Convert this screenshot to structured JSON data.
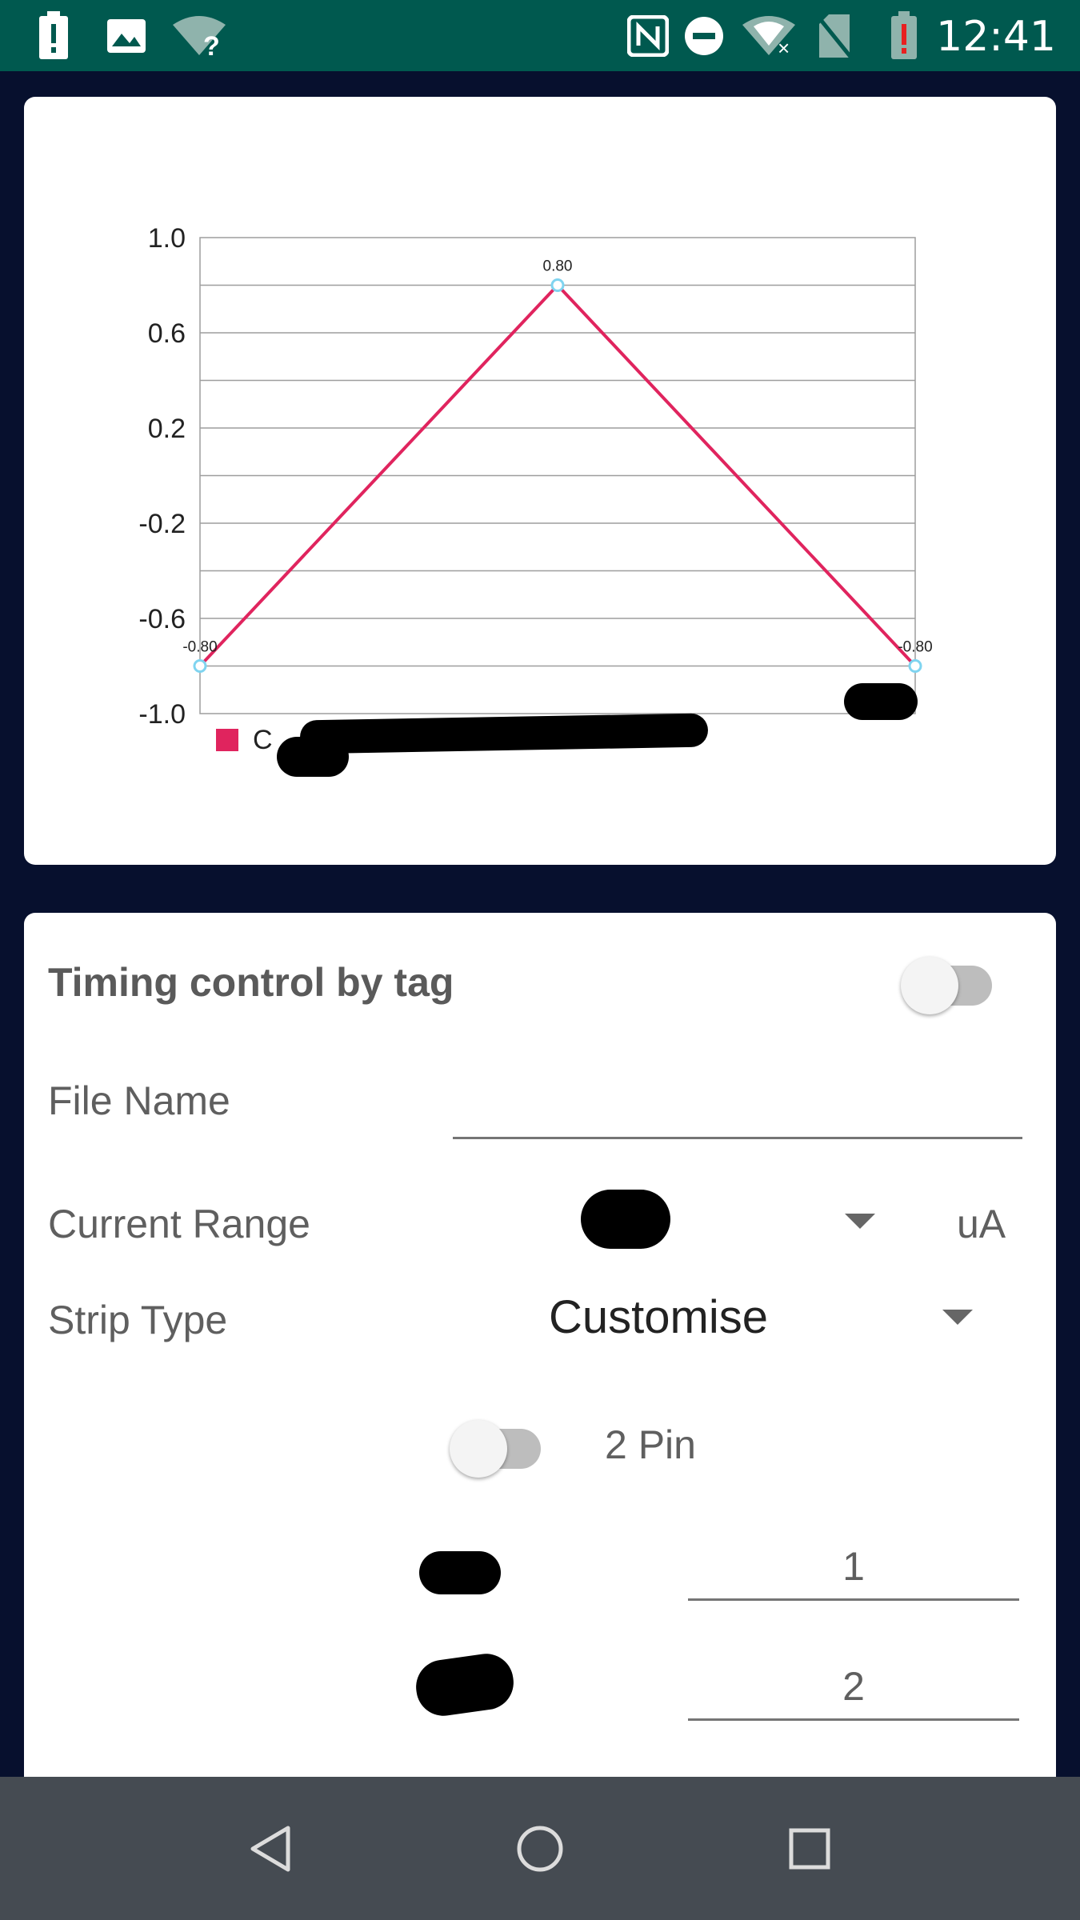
{
  "status_bar": {
    "time": "12:41",
    "left_icons": [
      "alert-icon",
      "image-icon",
      "wifi-unknown-icon"
    ],
    "right_icons": [
      "nfc-icon",
      "do-not-disturb-icon",
      "wifi-off-icon",
      "no-sim-icon",
      "battery-alert-icon"
    ],
    "wifi_unknown_glyph": "?"
  },
  "chart_data": {
    "type": "line",
    "x": [
      0,
      1,
      2
    ],
    "y_ticks": [
      "1.0",
      "0.6",
      "0.2",
      "-0.2",
      "-0.6",
      "-1.0"
    ],
    "ylim": [
      -1.0,
      1.0
    ],
    "series": [
      {
        "values": [
          -0.8,
          0.8,
          -0.8
        ],
        "color": "#e0245e",
        "point_color": "#7fd4f0",
        "data_labels": [
          "-0.80",
          "0.80",
          "-0.80"
        ]
      }
    ],
    "legend_text_visible": "C",
    "legend_position": "bottom-left",
    "grid": true
  },
  "form": {
    "timing_label": "Timing control by tag",
    "timing_enabled": false,
    "file_name_label": "File Name",
    "file_name_value": "",
    "current_range_label": "Current Range",
    "current_range_unit": "uA",
    "strip_type_label": "Strip Type",
    "strip_type_value": "Customise",
    "pin_toggle_label": "2 Pin",
    "pin_toggle_enabled": false,
    "field1_value": "1",
    "field2_value": "2"
  },
  "nav_bar": {
    "buttons": [
      "back-icon",
      "home-icon",
      "recents-icon"
    ]
  },
  "colors": {
    "status_bar": "#00594f",
    "background": "#07102e",
    "nav_bar": "#454b52",
    "series": "#e0245e"
  }
}
